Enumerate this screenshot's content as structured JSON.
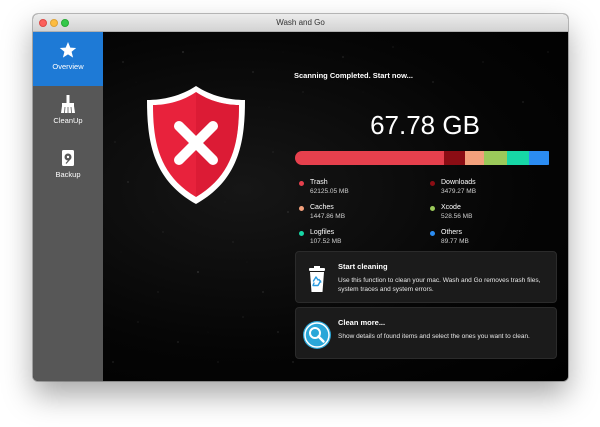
{
  "window": {
    "title": "Wash and Go"
  },
  "sidebar": {
    "items": [
      {
        "label": "Overview",
        "icon": "star-icon",
        "active": true
      },
      {
        "label": "CleanUp",
        "icon": "broom-icon",
        "active": false
      },
      {
        "label": "Backup",
        "icon": "disk-icon",
        "active": false
      }
    ]
  },
  "status": {
    "message": "Scanning Completed. Start now...",
    "state": "threat-found",
    "shield_icon": "shield-x-icon",
    "shield_color": "#e8223c"
  },
  "summary": {
    "total": "67.78 GB"
  },
  "usage_bar": {
    "segments": [
      {
        "name": "Trash",
        "fraction": 0.575,
        "color": "#e6404d"
      },
      {
        "name": "Downloads",
        "fraction": 0.08,
        "color": "#8b0d14"
      },
      {
        "name": "Caches",
        "fraction": 0.075,
        "color": "#f3a07c"
      },
      {
        "name": "Xcode",
        "fraction": 0.09,
        "color": "#9bc95a"
      },
      {
        "name": "Logfiles",
        "fraction": 0.085,
        "color": "#17d7a6"
      },
      {
        "name": "Others",
        "fraction": 0.075,
        "color": "#2b8cf2"
      }
    ]
  },
  "legend": {
    "items": [
      {
        "name": "Trash",
        "size": "62125.05 MB",
        "color": "#e6404d"
      },
      {
        "name": "Downloads",
        "size": "3479.27 MB",
        "color": "#8b0d14"
      },
      {
        "name": "Caches",
        "size": "1447.86 MB",
        "color": "#f3a07c"
      },
      {
        "name": "Xcode",
        "size": "528.56 MB",
        "color": "#9bc95a"
      },
      {
        "name": "Logfiles",
        "size": "107.52 MB",
        "color": "#17d7a6"
      },
      {
        "name": "Others",
        "size": "89.77 MB",
        "color": "#2b8cf2"
      }
    ]
  },
  "actions": {
    "start_cleaning": {
      "title": "Start cleaning",
      "description": "Use this function to clean your mac. Wash and Go removes trash files, system traces and system errors.",
      "icon": "recycle-bin-icon"
    },
    "clean_more": {
      "title": "Clean more...",
      "description": "Show details of found items and select the ones you want to clean.",
      "icon": "magnifier-icon"
    }
  }
}
